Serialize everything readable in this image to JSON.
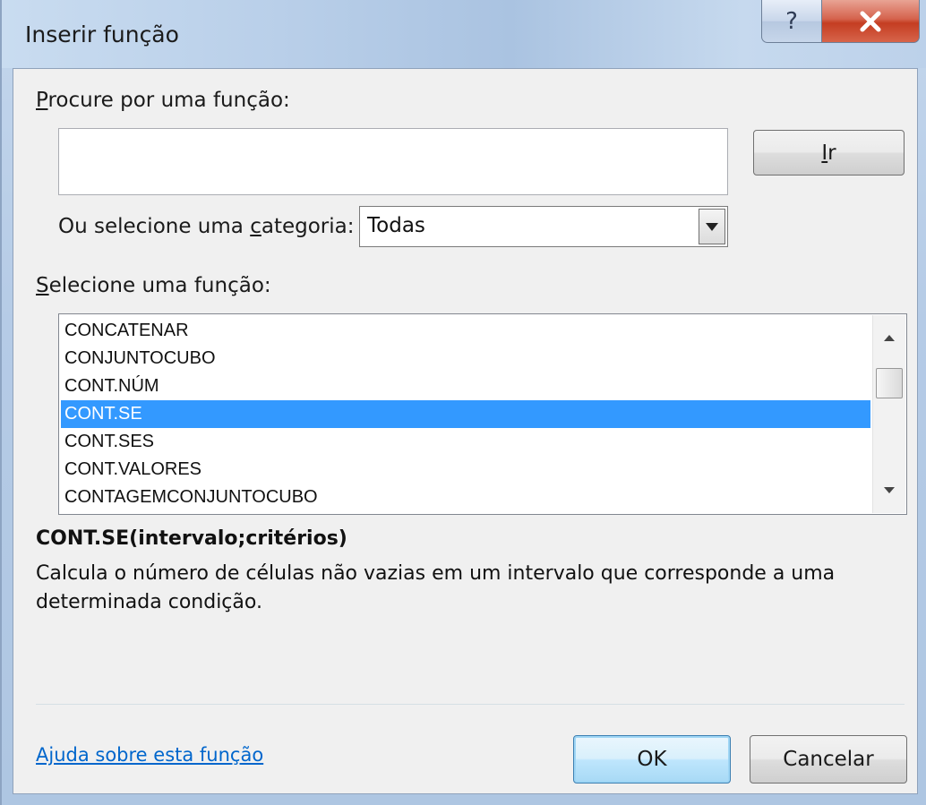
{
  "window": {
    "title": "Inserir função",
    "help_button": "?",
    "close_button": "X"
  },
  "search": {
    "label_first": "P",
    "label_rest": "rocure por uma função:",
    "value": "",
    "go_button_first": "I",
    "go_button_rest": "r"
  },
  "category": {
    "label_before": "Ou selecione uma ",
    "label_accel": "c",
    "label_after": "ategoria:",
    "selected": "Todas"
  },
  "function_list": {
    "label_first": "S",
    "label_rest": "elecione uma função:",
    "items": [
      {
        "name": "CONCATENAR",
        "selected": false
      },
      {
        "name": "CONJUNTOCUBO",
        "selected": false
      },
      {
        "name": "CONT.NÚM",
        "selected": false
      },
      {
        "name": "CONT.SE",
        "selected": true
      },
      {
        "name": "CONT.SES",
        "selected": false
      },
      {
        "name": "CONT.VALORES",
        "selected": false
      },
      {
        "name": "CONTAGEMCONJUNTOCUBO",
        "selected": false
      }
    ]
  },
  "details": {
    "signature": "CONT.SE(intervalo;critérios)",
    "description": "Calcula o número de células não vazias em um intervalo que corresponde a uma determinada condição."
  },
  "footer": {
    "help_link": "Ajuda sobre esta função",
    "ok_button": "OK",
    "cancel_button": "Cancelar"
  },
  "colors": {
    "selection": "#3399ff",
    "link": "#0066cc",
    "close_button": "#c43d22"
  }
}
